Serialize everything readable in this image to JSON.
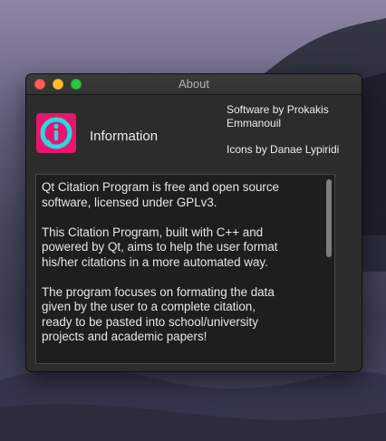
{
  "window": {
    "title": "About"
  },
  "app": {
    "name": "Information",
    "icon": "citation-logo-icon",
    "icon_colors": {
      "background": "#e8156f",
      "ring": "#2fd8d8",
      "inner": "#8a3fd0"
    }
  },
  "credits": {
    "line1": "Software by Prokakis",
    "line2": "Emmanouil",
    "line3": "Icons by Danae Lypiridi"
  },
  "description": {
    "paragraphs": [
      [
        "Qt Citation Program is free and open source",
        "software, licensed under GPLv3."
      ],
      [
        "This Citation Program, built with C++ and",
        "powered by Qt, aims to help the user format",
        "his/her citations in a more automated way."
      ],
      [
        "The program focuses on formating the data",
        "given by the user to a complete citation,",
        "ready to be pasted into school/university",
        "projects and academic papers!"
      ]
    ]
  },
  "traffic_lights": {
    "close": "#fe5f57",
    "minimize": "#febc2e",
    "maximize": "#28c840"
  }
}
